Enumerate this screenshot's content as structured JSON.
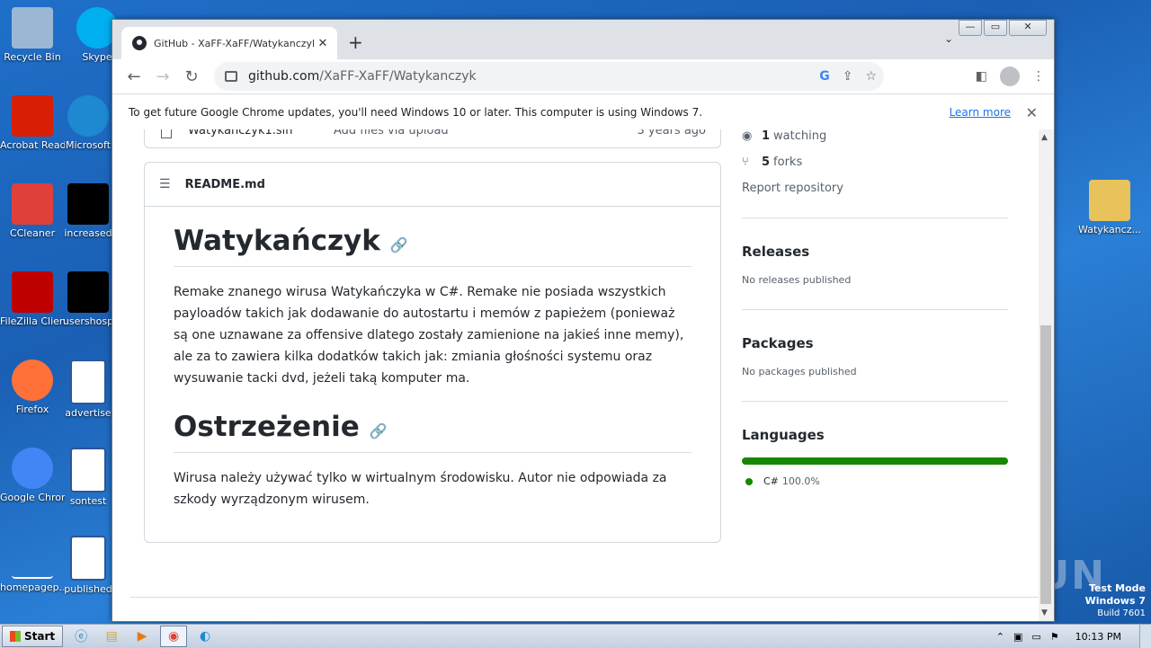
{
  "desktop": {
    "icons": [
      {
        "label": "Recycle Bin",
        "icon": "recycle-bin-icon",
        "color": "#9bb7d4"
      },
      {
        "label": "Skype",
        "icon": "skype-icon",
        "color": "#00aff0"
      },
      {
        "label": "Acrobat Reader DC",
        "icon": "acrobat-icon",
        "color": "#d81e05"
      },
      {
        "label": "Microsoft",
        "icon": "edge-icon",
        "color": "#1e88d0"
      },
      {
        "label": "CCleaner",
        "icon": "ccleaner-icon",
        "color": "#e0403a"
      },
      {
        "label": "increased",
        "icon": "black-file-icon",
        "color": "#000000"
      },
      {
        "label": "FileZilla Client",
        "icon": "filezilla-icon",
        "color": "#bf0000"
      },
      {
        "label": "usershosp",
        "icon": "black-file-icon",
        "color": "#000000"
      },
      {
        "label": "Firefox",
        "icon": "firefox-icon",
        "color": "#ff7139"
      },
      {
        "label": "advertise",
        "icon": "word-doc-icon",
        "color": "#2b5797"
      },
      {
        "label": "Google Chrome",
        "icon": "chrome-icon",
        "color": "#4285f4"
      },
      {
        "label": "sontest",
        "icon": "word-doc-icon",
        "color": "#2b5797"
      },
      {
        "label": "homepagep...",
        "icon": "blank-file-icon",
        "color": "#1a5fb4"
      },
      {
        "label": "published",
        "icon": "word-doc-icon",
        "color": "#2b5797"
      },
      {
        "label": "Watykancz...",
        "icon": "folder-icon",
        "color": "#e8c25a"
      }
    ],
    "watermark": "ANY RUN",
    "test_mode": {
      "line1": "Test Mode",
      "line2": "Windows 7",
      "line3": "Build 7601"
    }
  },
  "browser": {
    "tab_title": "GitHub - XaFF-XaFF/Watykanczyk: R",
    "url_host": "github.com",
    "url_path": "/XaFF-XaFF/Watykanczyk",
    "infobar_message": "To get future Google Chrome updates, you'll need Windows 10 or later. This computer is using Windows 7.",
    "infobar_link": "Learn more"
  },
  "repo": {
    "file_row": {
      "name": "Watykanczyk1.sln",
      "commit": "Add files via upload",
      "time": "3 years ago"
    },
    "readme_filename": "README.md",
    "heading1": "Watykańczyk",
    "paragraph1": "Remake znanego wirusa Watykańczyka w C#. Remake nie posiada wszystkich payloadów takich jak dodawanie do autostartu i memów z papieżem (ponieważ są one uznawane za offensive dlatego zostały zamienione na jakieś inne memy), ale za to zawiera kilka dodatków takich jak: zmiania głośności systemu oraz wysuwanie tacki dvd, jeżeli taką komputer ma.",
    "heading2": "Ostrzeżenie",
    "paragraph2": "Wirusa należy używać tylko w wirtualnym środowisku. Autor nie odpowiada za szkody wyrządzonym wirusem.",
    "sidebar": {
      "watching_count": "1",
      "watching_label": "watching",
      "forks_count": "5",
      "forks_label": "forks",
      "report": "Report repository",
      "releases_title": "Releases",
      "releases_text": "No releases published",
      "packages_title": "Packages",
      "packages_text": "No packages published",
      "languages_title": "Languages",
      "language_name": "C#",
      "language_percent": "100.0%",
      "language_fraction": 1.0,
      "language_color": "#178600"
    }
  },
  "taskbar": {
    "start_label": "Start",
    "clock": "10:13 PM"
  }
}
